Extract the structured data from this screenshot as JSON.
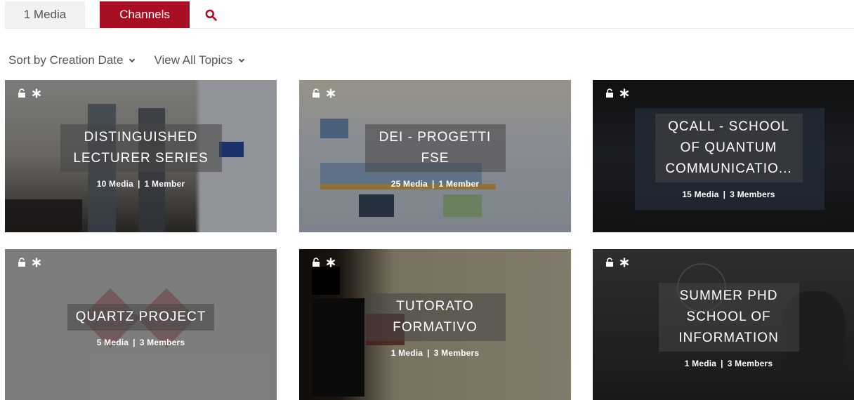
{
  "tabs": {
    "media": "1 Media",
    "channels": "Channels"
  },
  "filters": {
    "sort": "Sort by Creation Date",
    "topics": "View All Topics"
  },
  "channels": [
    {
      "title": "DISTINGUISHED LECTURER SERIES",
      "media": "10 Media",
      "members": "1 Member"
    },
    {
      "title": "DEI - PROGETTI FSE",
      "media": "25 Media",
      "members": "1 Member"
    },
    {
      "title": "QCALL - SCHOOL OF QUANTUM COMMUNICATIO...",
      "media": "15 Media",
      "members": "3 Members"
    },
    {
      "title": "QUARTZ PROJECT",
      "media": "5 Media",
      "members": "3 Members"
    },
    {
      "title": "TUTORATO FORMATIVO",
      "media": "1 Media",
      "members": "3 Members"
    },
    {
      "title": "SUMMER PHD SCHOOL OF INFORMATION",
      "media": "1 Media",
      "members": "3 Members"
    }
  ],
  "colors": {
    "accent": "#a80f23"
  }
}
